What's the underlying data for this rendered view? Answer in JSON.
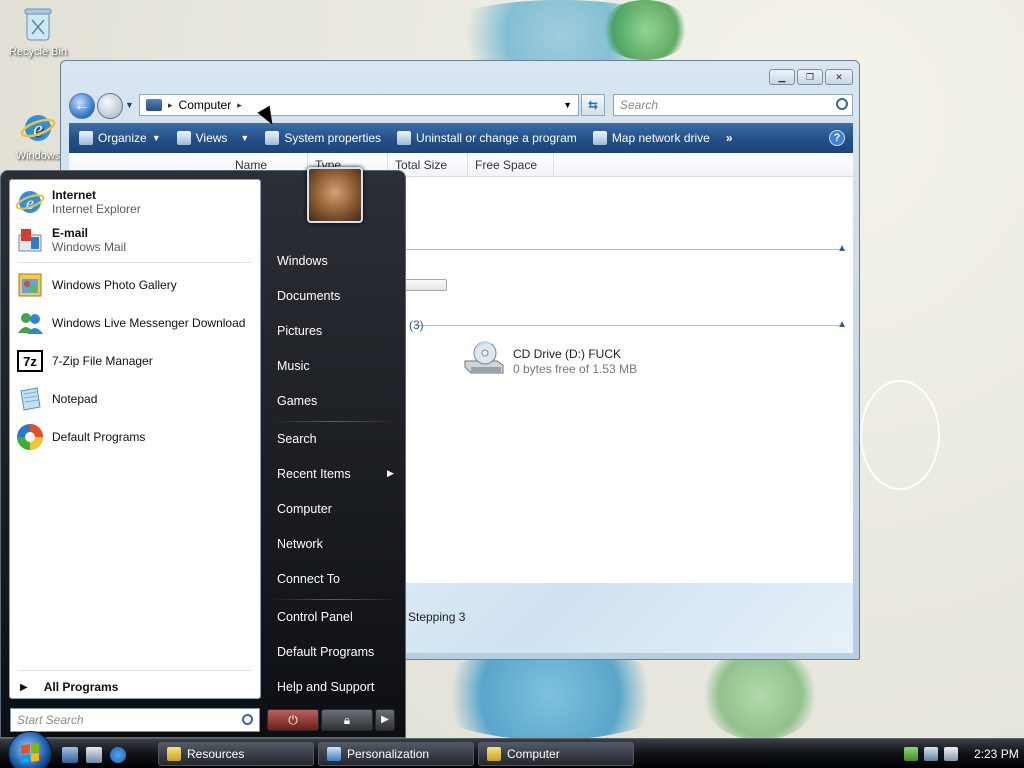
{
  "desktop": {
    "icons": [
      {
        "label": "Recycle Bin",
        "icon": "recycle-bin-icon"
      },
      {
        "label": "Windows",
        "icon": "internet-explorer-icon"
      }
    ]
  },
  "explorer": {
    "address": {
      "location": "Computer",
      "separator": "▸"
    },
    "search_placeholder": "Search",
    "toolbar": {
      "organize": "Organize",
      "views": "Views",
      "system_properties": "System properties",
      "uninstall": "Uninstall or change a program",
      "map_drive": "Map network drive",
      "more": "»",
      "help": "?"
    },
    "columns": [
      "Name",
      "Type",
      "Total Size",
      "Free Space"
    ],
    "groups": {
      "removable_label": "e (3)"
    },
    "drive": {
      "name": "CD Drive (D:) FUCK",
      "free": "0 bytes free of 1.53 MB"
    },
    "details_text": "Stepping 3"
  },
  "start_menu": {
    "pinned": [
      {
        "title": "Internet",
        "subtitle": "Internet Explorer",
        "icon": "internet-explorer-icon"
      },
      {
        "title": "E-mail",
        "subtitle": "Windows Mail",
        "icon": "windows-mail-icon"
      }
    ],
    "recent": [
      {
        "label": "Windows Photo Gallery",
        "icon": "photo-gallery-icon"
      },
      {
        "label": "Windows Live Messenger Download",
        "icon": "messenger-icon"
      },
      {
        "label": "7-Zip File Manager",
        "icon": "7zip-icon"
      },
      {
        "label": "Notepad",
        "icon": "notepad-icon"
      },
      {
        "label": "Default Programs",
        "icon": "default-programs-icon"
      }
    ],
    "all_programs": "All Programs",
    "search_placeholder": "Start Search",
    "right_items": {
      "windows": "Windows",
      "documents": "Documents",
      "pictures": "Pictures",
      "music": "Music",
      "games": "Games",
      "search": "Search",
      "recent_items": "Recent Items",
      "computer": "Computer",
      "network": "Network",
      "connect_to": "Connect To",
      "control_panel": "Control Panel",
      "default_programs": "Default Programs",
      "help_support": "Help and Support"
    }
  },
  "taskbar": {
    "buttons": [
      {
        "label": "Resources",
        "icon": "folder-icon"
      },
      {
        "label": "Personalization",
        "icon": "monitor-icon"
      },
      {
        "label": "Computer",
        "icon": "folder-icon"
      }
    ],
    "clock": "2:23 PM"
  },
  "colors": {
    "toolbar": "#234f86",
    "start_menu": "#0c0e12",
    "taskbar": "#101317"
  }
}
